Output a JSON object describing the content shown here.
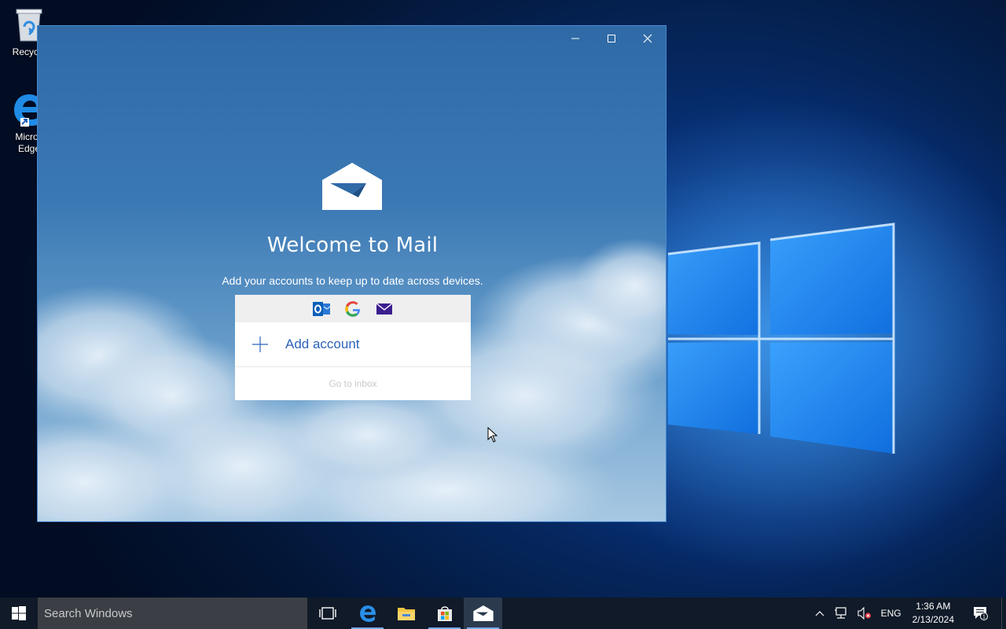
{
  "desktop": {
    "icons": [
      {
        "label": "Recycle"
      },
      {
        "label": "Micros"
      },
      {
        "label": "Edge"
      }
    ]
  },
  "window": {
    "controls": [
      "minimize-icon",
      "maximize-icon",
      "close-icon"
    ]
  },
  "mail": {
    "title": "Welcome to Mail",
    "subtitle": "Add your accounts to keep up to date across devices.",
    "providers": [
      "outlook-icon",
      "google-icon",
      "mail-icon"
    ],
    "add_account": "Add account",
    "go_to_inbox": "Go to inbox"
  },
  "taskbar": {
    "search_placeholder": "Search Windows",
    "pinned": [
      "task-view-icon",
      "edge-icon",
      "file-explorer-icon",
      "store-icon",
      "mail-icon"
    ],
    "language": "ENG",
    "time": "1:36 AM",
    "date": "2/13/2024",
    "notification_count": "1"
  },
  "colors": {
    "accent": "#2b63b8",
    "taskbar": "#101a28",
    "search_box": "#3b3f45"
  }
}
